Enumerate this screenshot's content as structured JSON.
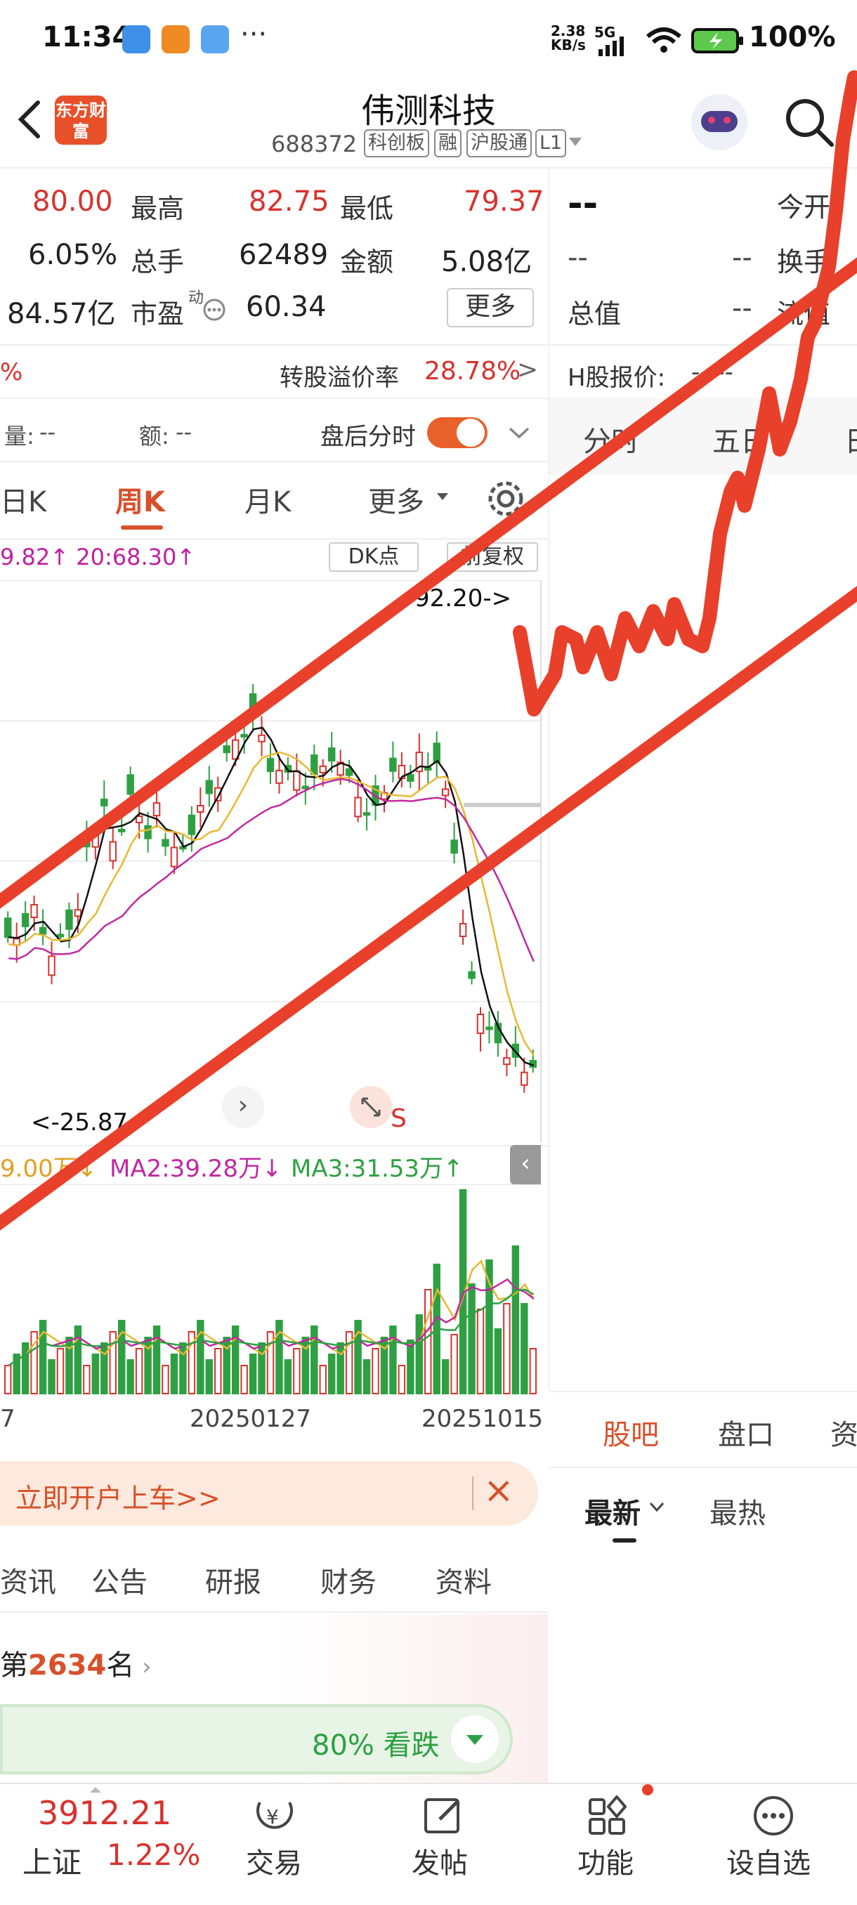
{
  "status": {
    "time": "11:34",
    "speed": "2.38 KB/s",
    "network": "5G",
    "battery": "100%"
  },
  "header": {
    "title": "伟测科技",
    "code": "688372",
    "tags": [
      "科创板",
      "融",
      "沪股通",
      "L1"
    ],
    "app_logo": "东方财富"
  },
  "quote": {
    "row1": {
      "open_val": "80.00",
      "high_label": "最高",
      "high_val": "82.75",
      "low_label": "最低",
      "low_val": "79.37"
    },
    "row2": {
      "turnover_pct": "6.05%",
      "vol_label": "总手",
      "vol_val": "62489",
      "amount_label": "金额",
      "amount_val": "5.08亿"
    },
    "row3": {
      "mktcap": "84.57亿",
      "pe_label": "市盈",
      "pe_sup": "动",
      "pe_val": "60.34",
      "more_btn": "更多"
    },
    "row4": {
      "premium_label": "转股溢价率",
      "premium_val": "28.78%"
    },
    "row5": {
      "vol_label": "量:",
      "vol_val": "--",
      "amt_label": "额:",
      "amt_val": "--",
      "after_hours_label": "盘后分时"
    }
  },
  "right_panel": {
    "price": "--",
    "today_open_label": "今开",
    "dash": "--",
    "turn_label": "换手",
    "total_label": "总值",
    "flow_label": "流值",
    "h_label": "H股报价:",
    "h_val": "-- --",
    "tabs": [
      "分时",
      "五日",
      "日"
    ],
    "bottom_tabs": [
      "股吧",
      "盘口",
      "资"
    ],
    "sort": [
      "最新",
      "最热"
    ]
  },
  "kline_tabs": {
    "items": [
      "日K",
      "周K",
      "月K",
      "更多"
    ],
    "active": "周K"
  },
  "chart": {
    "ma_line": "9.82↑ 20:68.30↑",
    "dk_btn": "DK点",
    "fq_btn": "前复权",
    "high_marker": "92.20->",
    "low_marker": "<-25.87",
    "vol_ma": {
      "ma1": "9.00万↓",
      "ma2": "MA2:39.28万↓",
      "ma3": "MA3:31.53万↑"
    },
    "dates": [
      "7",
      "20250127",
      "20251015"
    ],
    "s_mark": "S"
  },
  "promo": {
    "text": "立即开户上车>>"
  },
  "info_tabs": [
    "资讯",
    "公告",
    "研报",
    "财务",
    "资料"
  ],
  "rank": {
    "prefix": "第",
    "num": "2634",
    "suffix": "名"
  },
  "sentiment": {
    "text": "80% 看跌"
  },
  "bottom_nav": {
    "index_val": "3912.21",
    "index_name": "上证",
    "index_pct": "1.22%",
    "items": [
      "交易",
      "发帖",
      "功能",
      "设自选"
    ]
  },
  "colors": {
    "up": "#d8322e",
    "down": "#2ea043",
    "accent": "#d8502a",
    "annot": "#e8402a"
  }
}
